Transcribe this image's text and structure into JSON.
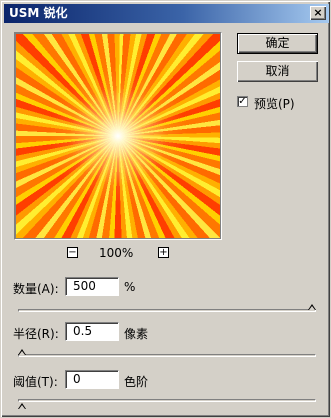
{
  "dialog": {
    "title": "USM 锐化",
    "close_glyph": "×"
  },
  "preview": {
    "zoom_out_glyph": "−",
    "zoom_in_glyph": "+",
    "zoom_level": "100%"
  },
  "buttons": {
    "ok": "确定",
    "cancel": "取消"
  },
  "preview_checkbox": {
    "label": "预览(P)",
    "checked": true,
    "check_glyph": "✓"
  },
  "amount": {
    "label": "数量(A):",
    "value": "500",
    "unit": "%",
    "slider_position": 0.99
  },
  "radius": {
    "label": "半径(R):",
    "value": "0.5",
    "unit": "像素",
    "slider_position": 0.0
  },
  "threshold": {
    "label": "阈值(T):",
    "value": "0",
    "unit": "色阶",
    "slider_position": 0.0
  },
  "colors": {
    "face": "#d4d0c8",
    "title_active": "#0a246a"
  },
  "icons": {
    "close": "close-icon",
    "zoom_out": "minus-icon",
    "zoom_in": "plus-icon",
    "check": "checkmark-icon"
  }
}
